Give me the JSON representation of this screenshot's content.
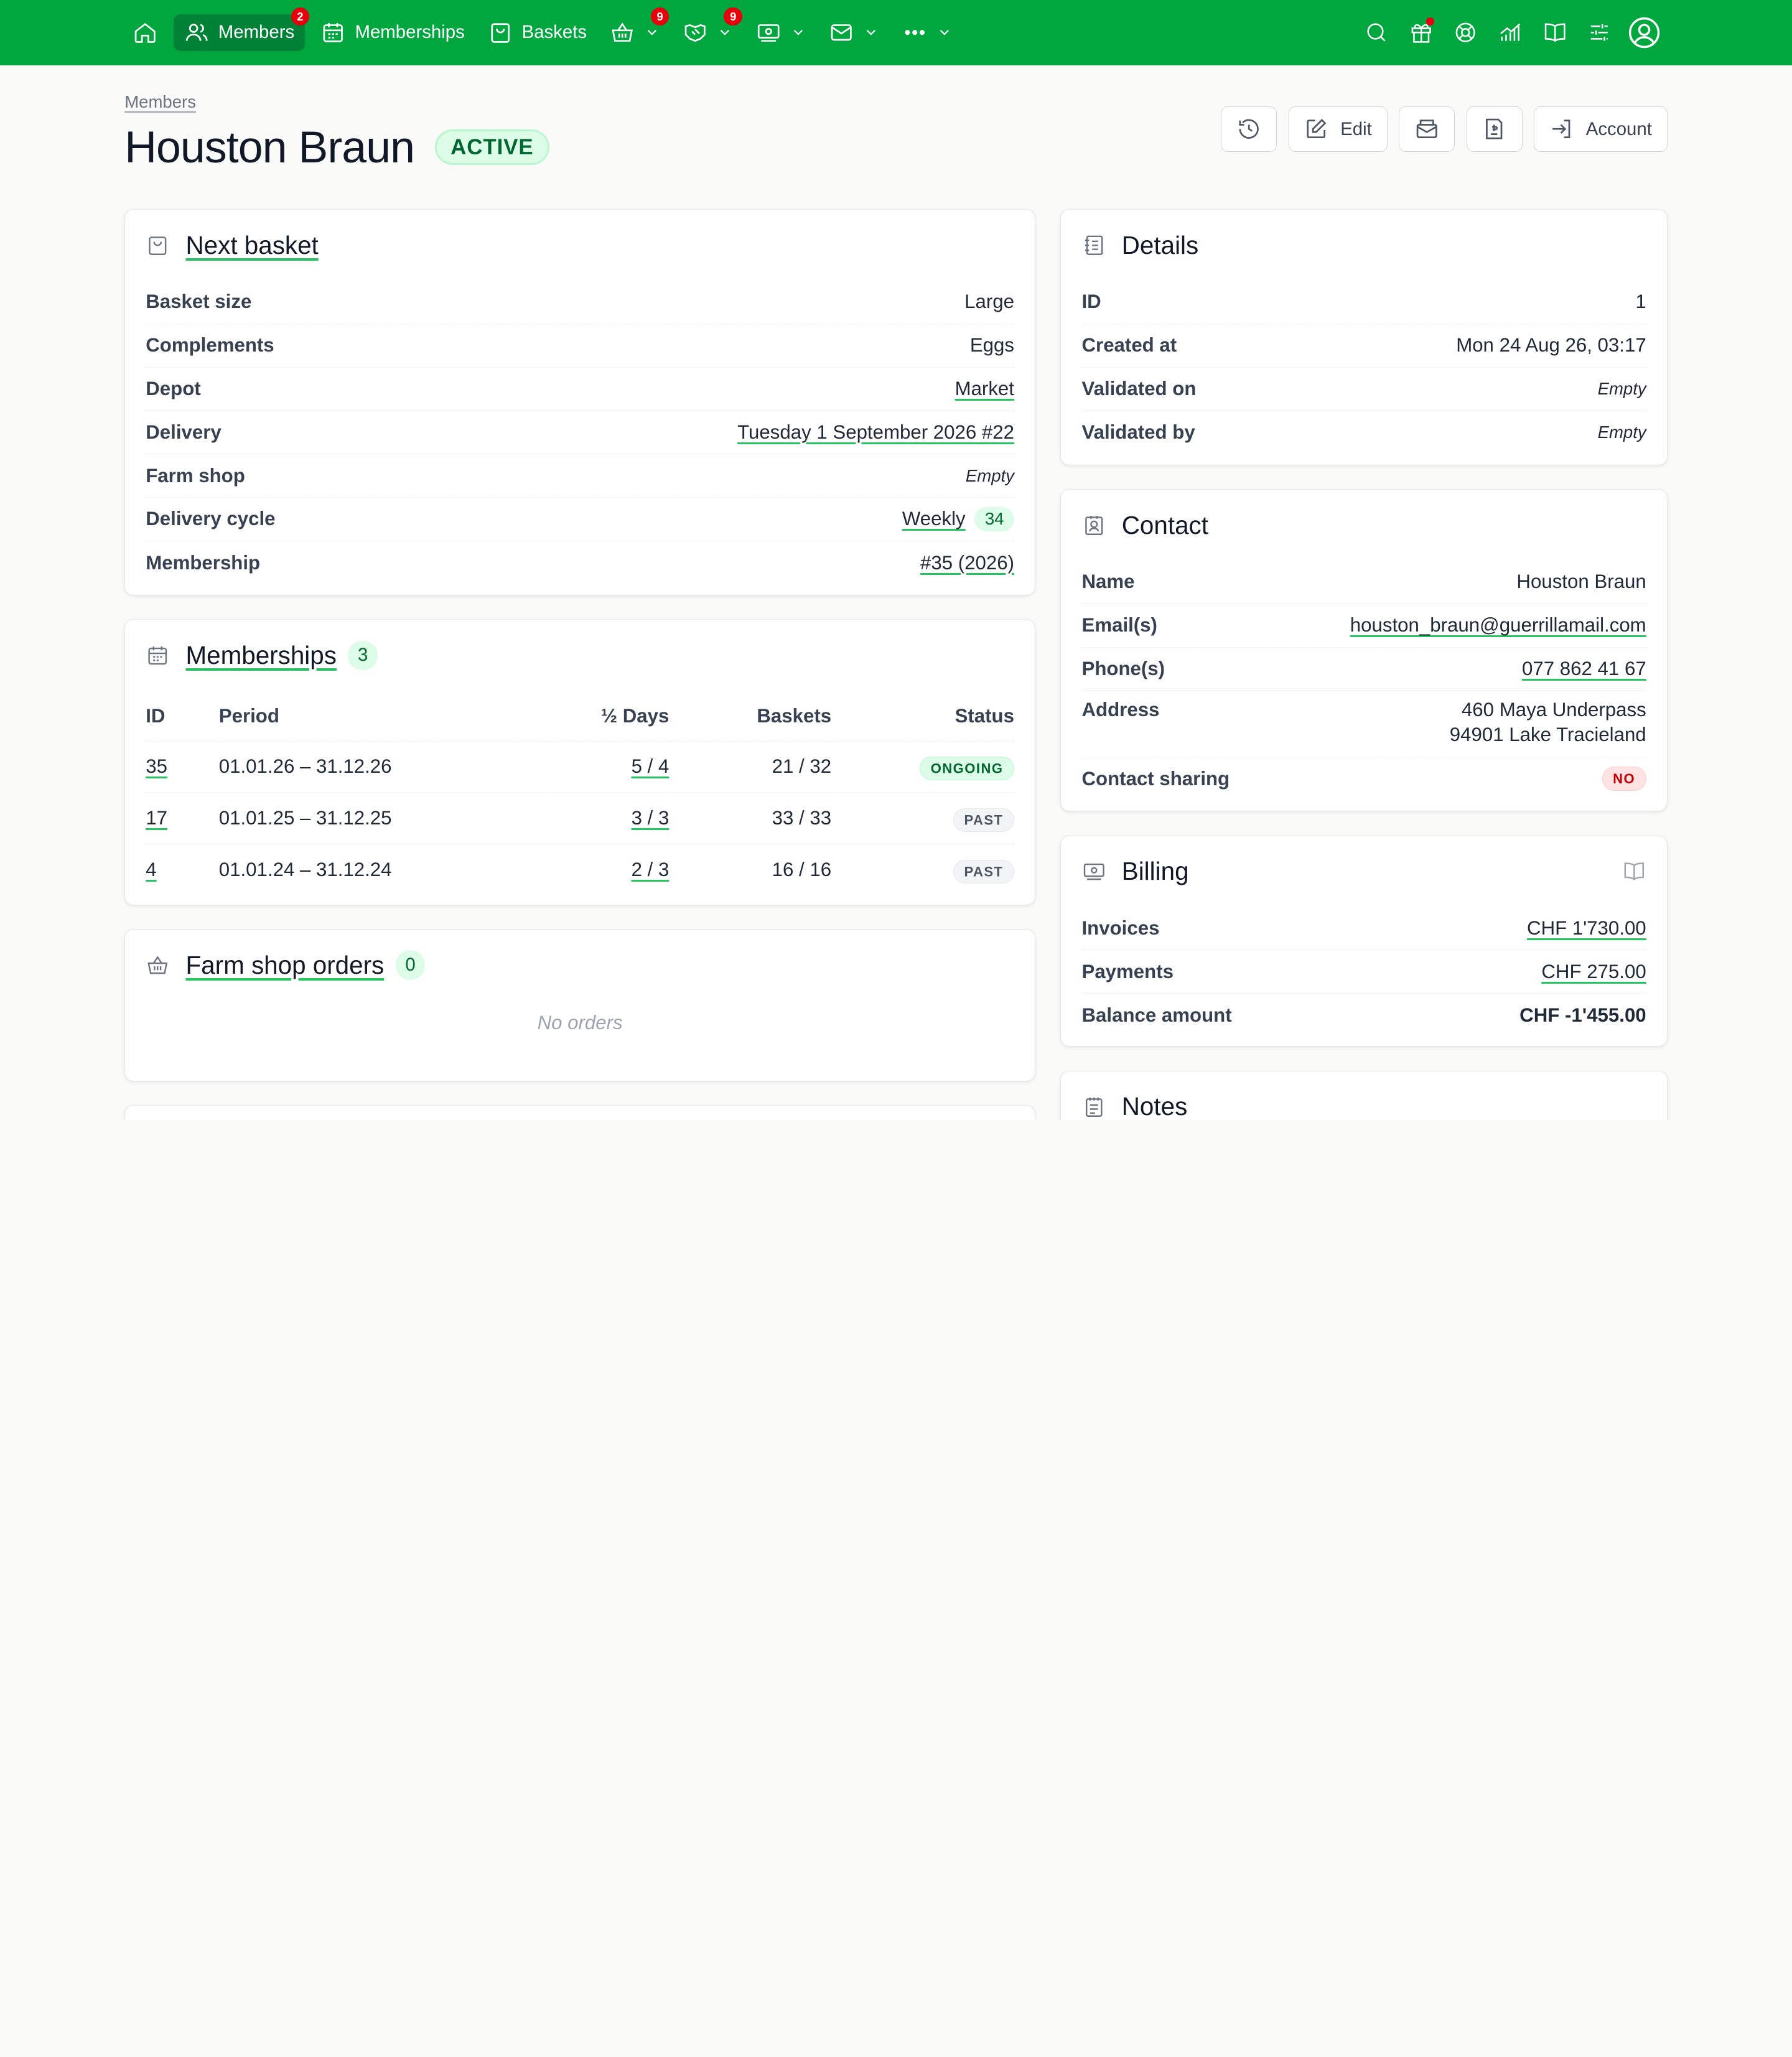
{
  "nav": {
    "members_label": "Members",
    "members_badge": "2",
    "memberships_label": "Memberships",
    "baskets_label": "Baskets",
    "shop_badge": "9",
    "activity_badge": "9"
  },
  "breadcrumb": "Members",
  "member": {
    "name": "Houston Braun",
    "state": "ACTIVE"
  },
  "actions": {
    "edit_label": "Edit",
    "account_label": "Account"
  },
  "next_basket": {
    "title": "Next basket",
    "rows": [
      {
        "label": "Basket size",
        "value": "Large"
      },
      {
        "label": "Complements",
        "value": "Eggs"
      },
      {
        "label": "Depot",
        "value": "Market"
      },
      {
        "label": "Delivery",
        "value": "Tuesday 1 September 2026 #22"
      },
      {
        "label": "Farm shop",
        "value": "Empty"
      },
      {
        "label": "Delivery cycle",
        "value": "Weekly",
        "badge": "34"
      },
      {
        "label": "Membership",
        "value": "#35 (2026)"
      }
    ]
  },
  "memberships": {
    "title": "Memberships",
    "count": "3",
    "headers": {
      "id": "ID",
      "period": "Period",
      "half_days": "½ Days",
      "baskets": "Baskets",
      "status": "Status"
    },
    "rows": [
      {
        "id": "35",
        "period": "01.01.26 – 31.12.26",
        "half_days": "5 / 4",
        "baskets": "21 / 32",
        "status": "ONGOING"
      },
      {
        "id": "17",
        "period": "01.01.25 – 31.12.25",
        "half_days": "3 / 3",
        "baskets": "33 / 33",
        "status": "PAST"
      },
      {
        "id": "4",
        "period": "01.01.24 – 31.12.24",
        "half_days": "2 / 3",
        "baskets": "16 / 16",
        "status": "PAST"
      }
    ]
  },
  "shop_orders": {
    "title": "Farm shop orders",
    "count": "0",
    "empty": "No orders"
  },
  "details": {
    "title": "Details",
    "rows": [
      {
        "label": "ID",
        "value": "1"
      },
      {
        "label": "Created at",
        "value": "Mon 24 Aug 26, 03:17"
      },
      {
        "label": "Validated on",
        "value": "Empty"
      },
      {
        "label": "Validated by",
        "value": "Empty"
      }
    ]
  },
  "contact": {
    "title": "Contact",
    "rows": [
      {
        "label": "Name",
        "value": "Houston Braun"
      },
      {
        "label": "Email(s)",
        "value": "houston_braun@guerrillamail.com"
      },
      {
        "label": "Phone(s)",
        "value": "077 862 41 67"
      },
      {
        "label": "Address",
        "value": "460 Maya Underpass",
        "value2": "94901 Lake Tracieland"
      },
      {
        "label": "Contact sharing",
        "value": "NO"
      }
    ]
  },
  "billing": {
    "title": "Billing",
    "rows": [
      {
        "label": "Invoices",
        "value": "CHF 1'730.00"
      },
      {
        "label": "Payments",
        "value": "CHF 275.00"
      },
      {
        "label": "Balance amount",
        "value": "CHF -1'455.00"
      }
    ]
  },
  "notes": {
    "title": "Notes"
  },
  "colors": {
    "brand": "#00a63e",
    "brand_dark": "#008236",
    "badge_red": "#e7000b"
  }
}
